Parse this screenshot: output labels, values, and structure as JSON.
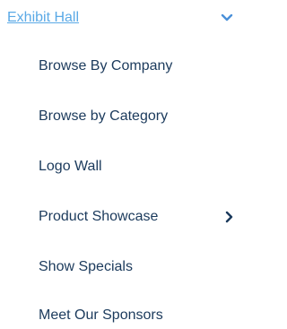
{
  "menu": {
    "header": {
      "label": "Exhibit Hall",
      "chevron_icon": "chevron-down-icon"
    },
    "items": [
      {
        "label": "Browse By Company",
        "has_submenu": false
      },
      {
        "label": "Browse by Category",
        "has_submenu": false
      },
      {
        "label": "Logo Wall",
        "has_submenu": false
      },
      {
        "label": "Product Showcase",
        "has_submenu": true,
        "chevron_icon": "chevron-right-icon"
      },
      {
        "label": "Show Specials",
        "has_submenu": false
      },
      {
        "label": "Meet Our Sponsors",
        "has_submenu": false
      }
    ]
  },
  "colors": {
    "link": "#5aa9e6",
    "text": "#1b3a5c",
    "chevron_header": "#4a90d9",
    "chevron_item": "#1b3a5c",
    "background": "#ffffff"
  }
}
